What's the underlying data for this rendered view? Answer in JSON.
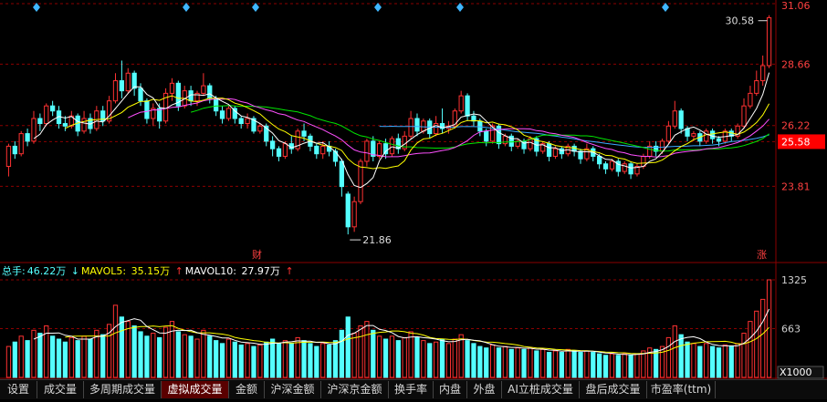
{
  "colors": {
    "up": "#ff3232",
    "down": "#54ffff",
    "ma5": "#ffffff",
    "ma10": "#ffff00",
    "ma20": "#ff50ff",
    "ma30": "#00e600",
    "ma60": "#3caaff",
    "grid": "#8b0000",
    "axis_text": "#ff4040",
    "highlight_bg": "#ff0000",
    "marker": "#3fb6ff"
  },
  "price_axis": {
    "ticks": [
      "31.06",
      "28.66",
      "26.22",
      "25.58",
      "23.81"
    ],
    "highlight": "25.58"
  },
  "annotations": {
    "high": "30.58",
    "low": "21.86",
    "event_cai": "财",
    "event_zhang": "涨"
  },
  "volume_axis": {
    "ticks": [
      "1325",
      "663"
    ],
    "unit": "X1000"
  },
  "indicator": {
    "total_label": "总手:",
    "total_value": "46.22万",
    "ma5_label": "MAVOL5:",
    "ma5_value": "35.15万",
    "ma10_label": "MAVOL10:",
    "ma10_value": "27.97万",
    "down_arrow": "↓",
    "up_arrow": "↑"
  },
  "tabs": [
    {
      "label": "设置",
      "active": false
    },
    {
      "label": "成交量",
      "active": false
    },
    {
      "label": "多周期成交量",
      "active": false
    },
    {
      "label": "虚拟成交量",
      "active": true
    },
    {
      "label": "金额",
      "active": false
    },
    {
      "label": "沪深金额",
      "active": false
    },
    {
      "label": "沪深京金额",
      "active": false
    },
    {
      "label": "换手率",
      "active": false
    },
    {
      "label": "内盘",
      "active": false
    },
    {
      "label": "外盘",
      "active": false
    },
    {
      "label": "AI立桩成交量",
      "active": false
    },
    {
      "label": "盘后成交量",
      "active": false
    },
    {
      "label": "市盈率(ttm)",
      "active": false
    }
  ],
  "chart_data": {
    "type": "candlestick",
    "ylim": [
      21.0,
      31.06
    ],
    "volume_ylim": [
      0,
      1325
    ],
    "candles": [
      [
        24.6,
        25.4,
        24.2,
        25.5
      ],
      [
        25.4,
        25.1,
        24.9,
        25.6
      ],
      [
        25.1,
        25.9,
        25.0,
        26.0
      ],
      [
        25.9,
        25.6,
        25.4,
        26.1
      ],
      [
        25.6,
        26.5,
        25.5,
        26.8
      ],
      [
        26.5,
        26.3,
        26.0,
        26.7
      ],
      [
        26.3,
        27.0,
        26.2,
        27.1
      ],
      [
        27.0,
        26.8,
        26.6,
        27.2
      ],
      [
        26.8,
        26.3,
        26.1,
        27.0
      ],
      [
        26.3,
        26.2,
        26.0,
        26.6
      ],
      [
        26.2,
        26.6,
        26.1,
        26.8
      ],
      [
        26.6,
        26.0,
        25.8,
        26.7
      ],
      [
        26.0,
        26.5,
        25.9,
        26.8
      ],
      [
        26.5,
        26.1,
        25.9,
        26.7
      ],
      [
        26.1,
        26.8,
        26.0,
        27.0
      ],
      [
        26.8,
        26.4,
        26.2,
        27.0
      ],
      [
        26.4,
        27.2,
        26.3,
        27.4
      ],
      [
        27.2,
        28.0,
        27.1,
        28.3
      ],
      [
        28.0,
        27.6,
        27.3,
        28.8
      ],
      [
        27.6,
        28.3,
        27.5,
        28.5
      ],
      [
        28.3,
        27.7,
        27.4,
        28.4
      ],
      [
        27.7,
        27.2,
        27.0,
        27.9
      ],
      [
        27.2,
        26.5,
        26.3,
        27.3
      ],
      [
        26.5,
        26.9,
        26.2,
        27.1
      ],
      [
        26.9,
        26.4,
        26.1,
        27.1
      ],
      [
        26.4,
        27.5,
        26.3,
        27.7
      ],
      [
        27.5,
        27.9,
        27.2,
        28.1
      ],
      [
        27.9,
        27.0,
        26.8,
        28.0
      ],
      [
        27.0,
        27.6,
        26.9,
        27.8
      ],
      [
        27.6,
        27.2,
        27.0,
        27.8
      ],
      [
        27.2,
        27.5,
        27.0,
        27.6
      ],
      [
        27.5,
        27.8,
        27.4,
        28.3
      ],
      [
        27.8,
        27.3,
        27.1,
        27.9
      ],
      [
        27.3,
        26.8,
        26.6,
        27.4
      ],
      [
        26.8,
        26.5,
        26.3,
        27.0
      ],
      [
        26.5,
        26.9,
        26.4,
        27.0
      ],
      [
        26.9,
        26.5,
        26.3,
        27.0
      ],
      [
        26.5,
        26.3,
        26.1,
        26.6
      ],
      [
        26.3,
        26.5,
        26.1,
        26.7
      ],
      [
        26.5,
        26.0,
        25.9,
        26.6
      ],
      [
        26.0,
        26.2,
        25.9,
        26.3
      ],
      [
        26.2,
        25.6,
        25.4,
        26.3
      ],
      [
        25.6,
        25.3,
        25.0,
        25.8
      ],
      [
        25.3,
        25.0,
        24.8,
        25.4
      ],
      [
        25.0,
        25.5,
        24.9,
        25.6
      ],
      [
        25.5,
        25.3,
        25.1,
        25.8
      ],
      [
        25.3,
        26.0,
        25.2,
        26.1
      ],
      [
        26.0,
        25.8,
        25.6,
        26.3
      ],
      [
        25.8,
        25.4,
        25.2,
        25.9
      ],
      [
        25.4,
        25.1,
        24.9,
        25.5
      ],
      [
        25.1,
        25.4,
        24.9,
        25.6
      ],
      [
        25.4,
        25.2,
        25.0,
        25.6
      ],
      [
        25.2,
        24.8,
        24.6,
        25.3
      ],
      [
        24.8,
        23.8,
        23.4,
        24.9
      ],
      [
        23.5,
        22.2,
        21.9,
        23.6
      ],
      [
        22.2,
        23.2,
        22.0,
        23.4
      ],
      [
        23.2,
        24.8,
        23.1,
        24.9
      ],
      [
        24.8,
        25.6,
        24.6,
        25.7
      ],
      [
        25.6,
        25.0,
        24.8,
        25.8
      ],
      [
        25.0,
        25.5,
        24.9,
        25.6
      ],
      [
        25.5,
        25.1,
        24.9,
        25.7
      ],
      [
        25.1,
        25.7,
        25.0,
        25.8
      ],
      [
        25.7,
        25.3,
        25.1,
        25.9
      ],
      [
        25.3,
        25.8,
        25.2,
        26.0
      ],
      [
        25.8,
        26.5,
        25.7,
        26.8
      ],
      [
        26.5,
        26.0,
        25.8,
        26.7
      ],
      [
        26.0,
        26.4,
        25.9,
        26.5
      ],
      [
        26.4,
        25.9,
        25.7,
        26.5
      ],
      [
        25.9,
        26.3,
        25.8,
        26.6
      ],
      [
        26.3,
        26.1,
        25.9,
        26.9
      ],
      [
        26.1,
        26.2,
        25.9,
        26.4
      ],
      [
        26.2,
        26.8,
        26.1,
        26.9
      ],
      [
        26.8,
        27.4,
        26.7,
        27.6
      ],
      [
        27.4,
        26.6,
        26.4,
        27.5
      ],
      [
        26.6,
        26.4,
        26.2,
        26.8
      ],
      [
        26.4,
        26.0,
        25.8,
        26.5
      ],
      [
        26.0,
        25.6,
        25.4,
        26.1
      ],
      [
        25.6,
        26.2,
        25.5,
        26.3
      ],
      [
        26.2,
        25.5,
        25.3,
        26.3
      ],
      [
        25.5,
        25.8,
        25.4,
        25.9
      ],
      [
        25.8,
        25.4,
        25.2,
        25.9
      ],
      [
        25.4,
        25.6,
        25.3,
        25.7
      ],
      [
        25.6,
        25.3,
        25.1,
        25.7
      ],
      [
        25.3,
        25.7,
        25.2,
        25.8
      ],
      [
        25.7,
        25.2,
        25.0,
        25.8
      ],
      [
        25.2,
        25.5,
        25.1,
        25.6
      ],
      [
        25.5,
        25.0,
        24.8,
        25.6
      ],
      [
        25.0,
        25.3,
        24.9,
        25.4
      ],
      [
        25.3,
        25.1,
        24.9,
        25.4
      ],
      [
        25.1,
        25.4,
        25.0,
        25.5
      ],
      [
        25.4,
        25.2,
        25.0,
        25.5
      ],
      [
        25.2,
        24.9,
        24.7,
        25.3
      ],
      [
        24.9,
        25.3,
        24.8,
        25.5
      ],
      [
        25.3,
        25.0,
        24.8,
        25.4
      ],
      [
        25.0,
        24.7,
        24.5,
        25.1
      ],
      [
        24.7,
        24.5,
        24.3,
        24.8
      ],
      [
        24.5,
        24.8,
        24.4,
        24.9
      ],
      [
        24.8,
        24.4,
        24.2,
        24.9
      ],
      [
        24.4,
        24.7,
        24.3,
        24.8
      ],
      [
        24.7,
        24.3,
        24.1,
        24.8
      ],
      [
        24.3,
        24.6,
        24.2,
        24.7
      ],
      [
        24.6,
        25.0,
        24.5,
        25.1
      ],
      [
        25.0,
        25.4,
        24.9,
        25.6
      ],
      [
        25.4,
        25.2,
        25.0,
        25.6
      ],
      [
        25.2,
        25.6,
        25.1,
        25.7
      ],
      [
        25.6,
        26.2,
        25.5,
        26.4
      ],
      [
        26.2,
        26.8,
        26.1,
        27.2
      ],
      [
        26.8,
        26.1,
        25.9,
        26.9
      ],
      [
        26.1,
        25.8,
        25.6,
        26.2
      ],
      [
        25.8,
        25.9,
        25.6,
        26.0
      ],
      [
        25.9,
        25.6,
        25.4,
        26.0
      ],
      [
        25.6,
        26.0,
        25.5,
        26.1
      ],
      [
        26.0,
        25.7,
        25.5,
        26.1
      ],
      [
        25.7,
        25.6,
        25.4,
        25.8
      ],
      [
        25.6,
        26.0,
        25.5,
        26.1
      ],
      [
        26.0,
        25.8,
        25.6,
        26.1
      ],
      [
        25.8,
        26.2,
        25.7,
        26.3
      ],
      [
        26.2,
        27.0,
        26.1,
        27.3
      ],
      [
        27.0,
        27.5,
        26.9,
        27.8
      ],
      [
        27.5,
        28.0,
        27.4,
        28.4
      ],
      [
        28.0,
        28.6,
        27.8,
        29.0
      ],
      [
        28.6,
        30.5,
        28.5,
        30.6
      ]
    ],
    "volume": [
      420,
      480,
      560,
      500,
      640,
      600,
      700,
      560,
      520,
      480,
      540,
      500,
      560,
      520,
      640,
      580,
      720,
      980,
      820,
      760,
      700,
      620,
      560,
      600,
      540,
      680,
      760,
      620,
      580,
      560,
      520,
      640,
      560,
      500,
      460,
      520,
      480,
      440,
      460,
      420,
      440,
      480,
      520,
      460,
      500,
      460,
      540,
      500,
      460,
      420,
      460,
      440,
      500,
      640,
      820,
      600,
      700,
      760,
      640,
      560,
      520,
      560,
      500,
      540,
      620,
      540,
      500,
      460,
      480,
      520,
      460,
      520,
      580,
      500,
      460,
      420,
      400,
      440,
      400,
      420,
      380,
      400,
      380,
      400,
      360,
      380,
      340,
      360,
      340,
      380,
      360,
      340,
      360,
      340,
      320,
      300,
      320,
      300,
      320,
      300,
      320,
      360,
      400,
      380,
      420,
      540,
      700,
      580,
      480,
      460,
      420,
      460,
      420,
      400,
      440,
      420,
      460,
      600,
      760,
      900,
      1060,
      1325
    ]
  }
}
